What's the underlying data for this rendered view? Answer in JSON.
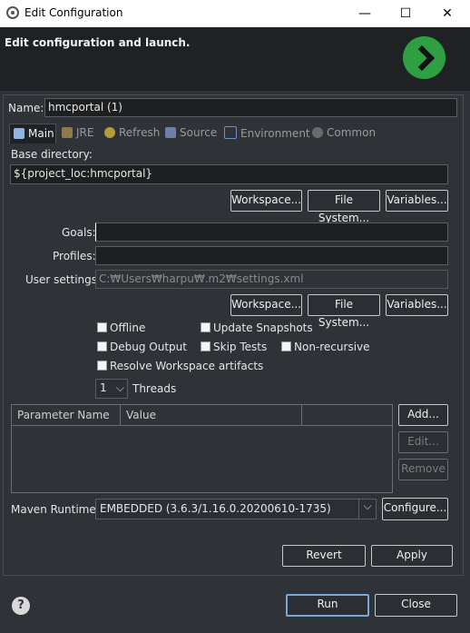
{
  "window": {
    "title": "Edit Configuration",
    "minimize": "—",
    "maximize": "☐",
    "close": "✕"
  },
  "header": {
    "title": "Edit configuration and launch."
  },
  "name": {
    "label": "Name:",
    "value": "hmcportal (1)"
  },
  "tabs": [
    {
      "label": "Main",
      "icon": "main-tab-icon",
      "active": true
    },
    {
      "label": "JRE",
      "icon": "jre-icon",
      "active": false
    },
    {
      "label": "Refresh",
      "icon": "refresh-icon",
      "active": false
    },
    {
      "label": "Source",
      "icon": "source-icon",
      "active": false
    },
    {
      "label": "Environment",
      "icon": "environment-icon",
      "active": false
    },
    {
      "label": "Common",
      "icon": "gear-icon",
      "active": false
    }
  ],
  "base": {
    "label": "Base directory:",
    "value": "${project_loc:hmcportal}",
    "buttons": {
      "workspace": "Workspace...",
      "filesystem": "File System...",
      "variables": "Variables..."
    }
  },
  "goals": {
    "label": "Goals:",
    "value": ""
  },
  "profiles": {
    "label": "Profiles:",
    "value": ""
  },
  "user_settings": {
    "label": "User settings:",
    "placeholder": "C:₩Users₩harpu₩.m2₩settings.xml",
    "buttons": {
      "workspace": "Workspace...",
      "filesystem": "File System...",
      "variables": "Variables..."
    }
  },
  "options": {
    "offline": "Offline",
    "update_snapshots": "Update Snapshots",
    "debug_output": "Debug Output",
    "skip_tests": "Skip Tests",
    "non_recursive": "Non-recursive",
    "resolve_workspace": "Resolve Workspace artifacts",
    "threads_value": "1",
    "threads_label": "Threads"
  },
  "params": {
    "columns": [
      "Parameter Name",
      "Value"
    ],
    "add": "Add...",
    "edit": "Edit...",
    "remove": "Remove"
  },
  "runtime": {
    "label": "Maven Runtime:",
    "value": "EMBEDDED (3.6.3/1.16.0.20200610-1735)",
    "configure": "Configure..."
  },
  "actions": {
    "revert": "Revert",
    "apply": "Apply"
  },
  "footer": {
    "help": "?",
    "run": "Run",
    "close": "Close"
  },
  "colors": {
    "accent_green": "#2ea043",
    "focus_blue": "#7aa7d8"
  }
}
